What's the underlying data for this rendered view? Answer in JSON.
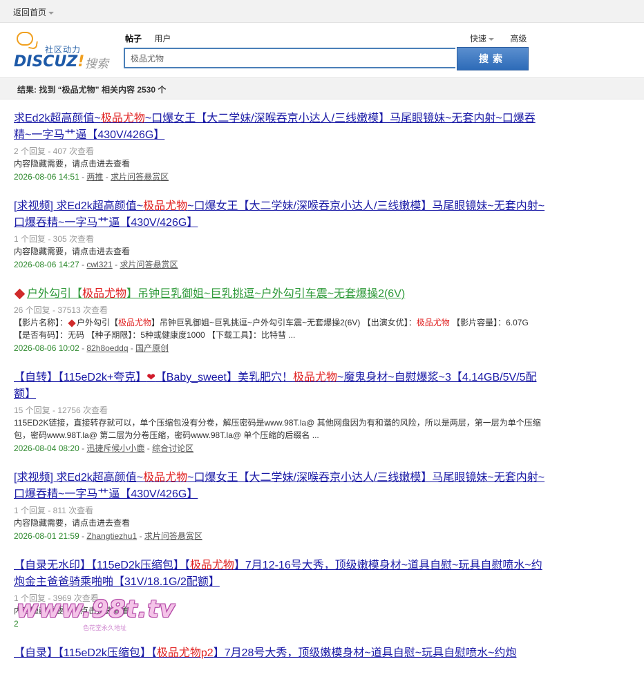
{
  "topbar": {
    "home_label": "返回首页"
  },
  "logo": {
    "tagline": "社区动力",
    "brand": "DISCUZ",
    "brand_excl": "!",
    "search_word": "搜索"
  },
  "tabs": [
    {
      "label": "帖子",
      "active": true
    },
    {
      "label": "用户",
      "active": false
    }
  ],
  "right_links": {
    "quick": "快速",
    "advanced": "高级"
  },
  "search": {
    "value": "极品尤物",
    "button": "搜索"
  },
  "result_summary": "结果: 找到 “极品尤物” 相关内容 2530 个",
  "results": [
    {
      "title_pre": "求Ed2k超高颜值~",
      "title_hl": "极品尤物",
      "title_post": "~口爆女王【大二学妹/深喉吞京小达人/三线嫩模】马尾眼镜妹~无套内射~口爆吞精~一字马艹逼【430V/426G】",
      "meta": "2 个回复 - 407 次查看",
      "body": "内容隐藏需要，请点击进去查看",
      "date": "2026-08-06 14:51",
      "user": "两推",
      "forum": "求片问答悬赏区"
    },
    {
      "title_pre": "[求视频] 求Ed2k超高颜值~",
      "title_hl": "极品尤物",
      "title_post": "~口爆女王【大二学妹/深喉吞京小达人/三线嫩模】马尾眼镜妹~无套内射~口爆吞精~一字马艹逼【430V/426G】",
      "meta": "1 个回复 - 305 次查看",
      "body": "内容隐藏需要，请点击进去查看",
      "date": "2026-08-06 14:27",
      "user": "cwl321",
      "forum": "求片问答悬赏区"
    },
    {
      "title_pre": "户外勾引【",
      "title_hl": "极品尤物",
      "title_post": "】吊钟巨乳御姐~巨乳挑逗~户外勾引车震~无套爆操2(6V)",
      "meta": "26 个回复 - 37513 次查看",
      "body_a": "【影片名称】：",
      "body_b": "户外勾引【",
      "body_hl": "极品尤物",
      "body_c": "】吊钟巨乳御姐~巨乳挑逗~户外勾引车震~无套爆操2(6V) 【出演女优】：",
      "body_hl2": "极品尤物",
      "body_d": " 【影片容量】：6.07G 【是否有码】：无码 【种子期限】：5种或健康度1000 【下载工具】：比特彗 ...",
      "date": "2026-08-06 10:02",
      "user": "82h8oeddq",
      "forum": "国产原创"
    },
    {
      "title_pre": "【自转】【115eD2k+夸克】",
      "title_mid": "【Baby_sweet】美乳肥穴！",
      "title_hl": "极品尤物",
      "title_post": "~魔鬼身材~自慰爆浆~3【4.14GB/5V/5配额】",
      "meta": "15 个回复 - 12756 次查看",
      "body": "115ED2K链接，直接转存就可以，单个压缩包没有分卷，解压密码是www.98T.la@ 其他网盘因为有和谐的风险，所以是两层，第一层为单个压缩包，密码www.98T.la@ 第二层为分卷压缩，密码www.98T.la@ 单个压缩的后缀名 ...",
      "date": "2026-08-04 08:20",
      "user": "迅捷斥候小小鹿",
      "forum": "综合讨论区"
    },
    {
      "title_pre": "[求视频] 求Ed2k超高颜值~",
      "title_hl": "极品尤物",
      "title_post": "~口爆女王【大二学妹/深喉吞京小达人/三线嫩模】马尾眼镜妹~无套内射~口爆吞精~一字马艹逼【430V/426G】",
      "meta": "1 个回复 - 811 次查看",
      "body": "内容隐藏需要，请点击进去查看",
      "date": "2026-08-01 21:59",
      "user": "Zhangtiezhu1",
      "forum": "求片问答悬赏区"
    },
    {
      "title_pre": "【自录无水印】【115eD2k压缩包】【",
      "title_hl": "极品尤物",
      "title_post": "】7月12-16号大秀，顶级嫩模身材~道具自慰~玩具自慰喷水~约炮金主爸爸骑乘啪啪【31V/18.1G/2配额】",
      "meta": "1 个回复 - 3969 次查看",
      "body": "内容隐藏需要，请点击进去查看",
      "date": "2",
      "user": "",
      "forum": ""
    },
    {
      "title_pre": "【自录】【115eD2k压缩包】【",
      "title_hl": "极品尤物p2",
      "title_post": "】7月28号大秀，顶级嫩模身材~道具自慰~玩具自慰喷水~约炮"
    }
  ],
  "watermark": {
    "text": "www.98t.tv",
    "sub": "色花堂永久地址"
  }
}
